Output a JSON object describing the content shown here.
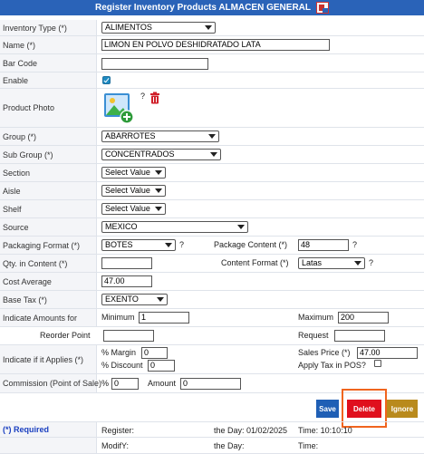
{
  "title": "Register Inventory Products ALMACEN GENERAL",
  "fields": {
    "inventory_type": {
      "label": "Inventory Type (*)",
      "value": "ALIMENTOS"
    },
    "name": {
      "label": "Name (*)",
      "value": "LIMON EN POLVO DESHIDRATADO LATA"
    },
    "bar_code": {
      "label": "Bar Code",
      "value": ""
    },
    "enable": {
      "label": "Enable",
      "checked": true
    },
    "photo": {
      "label": "Product Photo",
      "help": "?"
    },
    "group": {
      "label": "Group (*)",
      "value": "ABARROTES"
    },
    "sub_group": {
      "label": "Sub Group (*)",
      "value": "CONCENTRADOS"
    },
    "section": {
      "label": "Section",
      "value": "Select Value"
    },
    "aisle": {
      "label": "Aisle",
      "value": "Select Value"
    },
    "shelf": {
      "label": "Shelf",
      "value": "Select Value"
    },
    "source": {
      "label": "Source",
      "value": "MEXICO"
    },
    "packaging_format": {
      "label": "Packaging Format (*)",
      "value": "BOTES",
      "help": "?"
    },
    "package_content": {
      "label": "Package Content (*)",
      "value": "48",
      "help": "?"
    },
    "qty_in_content": {
      "label": "Qty. in Content (*)",
      "value": ""
    },
    "content_format": {
      "label": "Content Format (*)",
      "value": "Latas",
      "help": "?"
    },
    "cost_average": {
      "label": "Cost Average",
      "value": "47.00"
    },
    "base_tax": {
      "label": "Base Tax (*)",
      "value": "EXENTO"
    },
    "indicate_amounts": {
      "label": "Indicate Amounts for",
      "minimum_label": "Minimum",
      "minimum_value": "1",
      "maximum_label": "Maximum",
      "maximum_value": "200"
    },
    "reorder": {
      "reorder_label": "Reorder Point",
      "reorder_value": "",
      "request_label": "Request",
      "request_value": ""
    },
    "indicate_if": {
      "label": "Indicate if it Applies (*)",
      "margin_label": "% Margin",
      "margin_value": "0",
      "discount_label": "% Discount",
      "discount_value": "0",
      "sales_price_label": "Sales Price (*)",
      "sales_price_value": "47.00",
      "apply_tax_label": "Apply Tax in POS?",
      "apply_tax_checked": false
    },
    "commission": {
      "label": "Commission (Point of Sale)",
      "percent_label": "%",
      "percent_value": "0",
      "amount_label": "Amount",
      "amount_value": "0"
    }
  },
  "buttons": {
    "save": "Save",
    "delete": "Delete",
    "ignore": "Ignore"
  },
  "footer": {
    "required": "(*) Required",
    "register_label": "Register:",
    "register_day": "the Day: 01/02/2025",
    "register_time": "Time: 10:10:10",
    "modify_label": "ModifY:",
    "modify_day": "the Day:",
    "modify_time": "Time:"
  },
  "colors": {
    "title_bg": "#2a63b8",
    "save_bg": "#1f5fb5",
    "delete_bg": "#e0101d",
    "ignore_bg": "#b98a1c",
    "focus_ring": "#f0641e"
  },
  "icons": [
    "document-icon",
    "image-add-icon",
    "trash-icon",
    "help-icon",
    "checkbox-icon"
  ]
}
